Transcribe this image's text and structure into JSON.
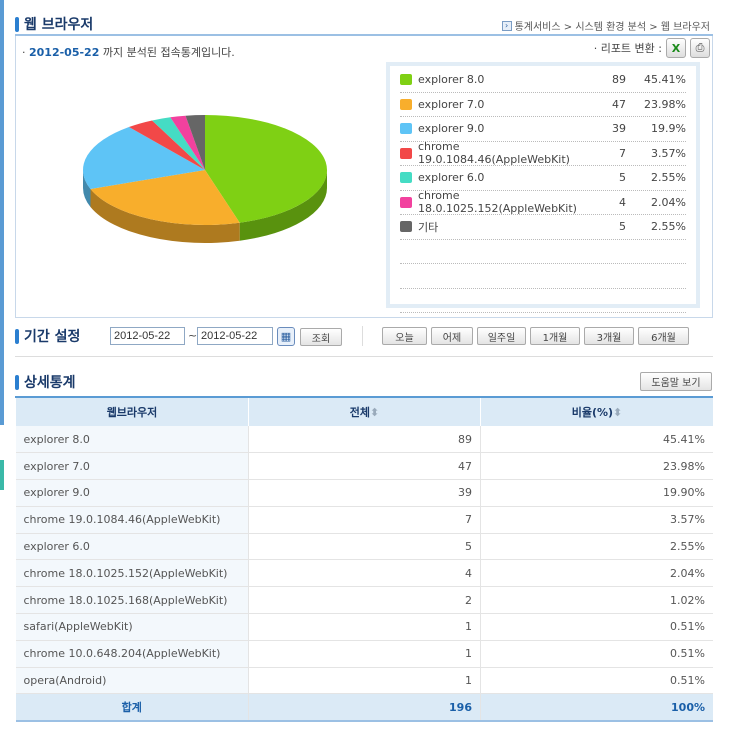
{
  "header": {
    "title": "웹 브라우저",
    "breadcrumb": "통계서비스 > 시스템 환경 분석 > 웹 브라우저"
  },
  "summary": {
    "date": "2012-05-22",
    "suffix": "까지 분석된 접속통계입니다.",
    "report_label": "· 리포트 변환 :"
  },
  "colors": [
    "#7fd014",
    "#f8ae2c",
    "#5ec4f6",
    "#f24848",
    "#45dcc4",
    "#f2419e",
    "#666666"
  ],
  "legend": [
    {
      "name": "explorer 8.0",
      "count": "89",
      "pct": "45.41%",
      "value": 45.41
    },
    {
      "name": "explorer 7.0",
      "count": "47",
      "pct": "23.98%",
      "value": 23.98
    },
    {
      "name": "explorer 9.0",
      "count": "39",
      "pct": "19.9%",
      "value": 19.9
    },
    {
      "name": "chrome 19.0.1084.46(AppleWebKit)",
      "count": "7",
      "pct": "3.57%",
      "value": 3.57
    },
    {
      "name": "explorer 6.0",
      "count": "5",
      "pct": "2.55%",
      "value": 2.55
    },
    {
      "name": "chrome 18.0.1025.152(AppleWebKit)",
      "count": "4",
      "pct": "2.04%",
      "value": 2.04
    },
    {
      "name": "기타",
      "count": "5",
      "pct": "2.55%",
      "value": 2.55
    }
  ],
  "period": {
    "title": "기간 설정",
    "from": "2012-05-22",
    "tilde": "~",
    "to": "2012-05-22",
    "search": "조회",
    "quick": [
      "오늘",
      "어제",
      "일주일",
      "1개월",
      "3개월",
      "6개월"
    ]
  },
  "detail": {
    "title": "상세통계",
    "help": "도움말 보기",
    "columns": [
      "웹브라우저",
      "전체",
      "비율(%)"
    ],
    "rows": [
      [
        "explorer 8.0",
        "89",
        "45.41%"
      ],
      [
        "explorer 7.0",
        "47",
        "23.98%"
      ],
      [
        "explorer 9.0",
        "39",
        "19.90%"
      ],
      [
        "chrome 19.0.1084.46(AppleWebKit)",
        "7",
        "3.57%"
      ],
      [
        "explorer 6.0",
        "5",
        "2.55%"
      ],
      [
        "chrome 18.0.1025.152(AppleWebKit)",
        "4",
        "2.04%"
      ],
      [
        "chrome 18.0.1025.168(AppleWebKit)",
        "2",
        "1.02%"
      ],
      [
        "safari(AppleWebKit)",
        "1",
        "0.51%"
      ],
      [
        "chrome 10.0.648.204(AppleWebKit)",
        "1",
        "0.51%"
      ],
      [
        "opera(Android)",
        "1",
        "0.51%"
      ]
    ],
    "total": [
      "합계",
      "196",
      "100%"
    ]
  }
}
